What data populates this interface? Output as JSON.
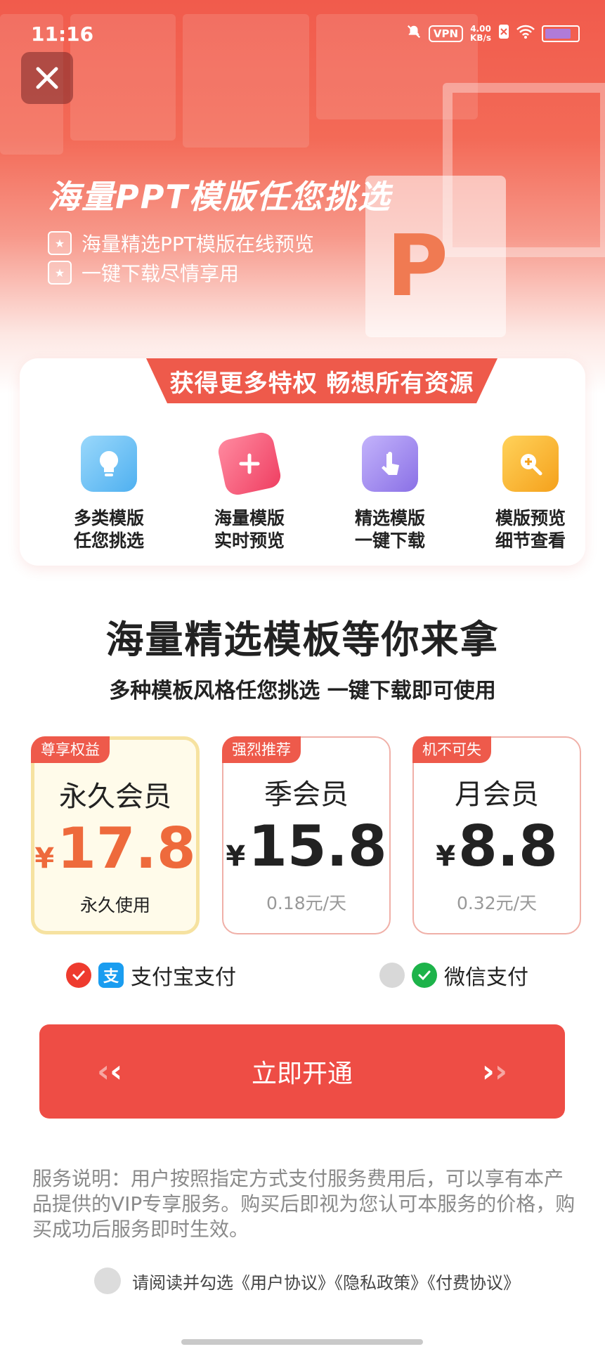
{
  "status_bar": {
    "time": "11:16",
    "vpn": "VPN",
    "speed_value": "4.00",
    "speed_unit": "KB/s",
    "icons": [
      "bell-off-icon",
      "vpn-icon",
      "no-sim-icon",
      "wifi-icon",
      "battery-icon"
    ]
  },
  "hero": {
    "title": "海量PPT模版任您挑选",
    "bullets": [
      "海量精选PPT模版在线预览",
      "一键下载尽情享用"
    ],
    "logo_letter": "P"
  },
  "privileges": {
    "banner": "获得更多特权 畅想所有资源",
    "items": [
      {
        "label": "多类模版\n任您挑选",
        "icon": "lightbulb-icon",
        "color": "#6ec3f5"
      },
      {
        "label": "海量模版\n实时预览",
        "icon": "plus-icon",
        "color": "#f35a72"
      },
      {
        "label": "精选模版\n一键下载",
        "icon": "touch-icon",
        "color": "#9b86ec"
      },
      {
        "label": "模版预览\n细节查看",
        "icon": "magnifier-icon",
        "color": "#f7b52a"
      }
    ]
  },
  "headline": "海量精选模板等你来拿",
  "subheadline": "多种模板风格任您挑选 一键下载即可使用",
  "plans": [
    {
      "tag": "尊享权益",
      "name": "永久会员",
      "currency": "¥",
      "price": "17.8",
      "note": "永久使用",
      "selected": true
    },
    {
      "tag": "强烈推荐",
      "name": "季会员",
      "currency": "¥",
      "price": "15.8",
      "note": "0.18元/天",
      "selected": false
    },
    {
      "tag": "机不可失",
      "name": "月会员",
      "currency": "¥",
      "price": "8.8",
      "note": "0.32元/天",
      "selected": false
    }
  ],
  "payment": {
    "alipay": {
      "label": "支付宝支付",
      "logo": "支",
      "selected": true
    },
    "wechat": {
      "label": "微信支付",
      "selected": false
    }
  },
  "cta": {
    "label": "立即开通"
  },
  "service_note": "服务说明：用户按照指定方式支付服务费用后，可以享有本产品提供的VIP专享服务。购买后即视为您认可本服务的价格，购买成功后服务即时生效。",
  "agreement": {
    "text": "请阅读并勾选《用户协议》《隐私政策》《付费协议》"
  },
  "colors": {
    "accent": "#ee4d45",
    "gold_border": "#f6e2a0",
    "price_highlight": "#ee6a3c"
  }
}
